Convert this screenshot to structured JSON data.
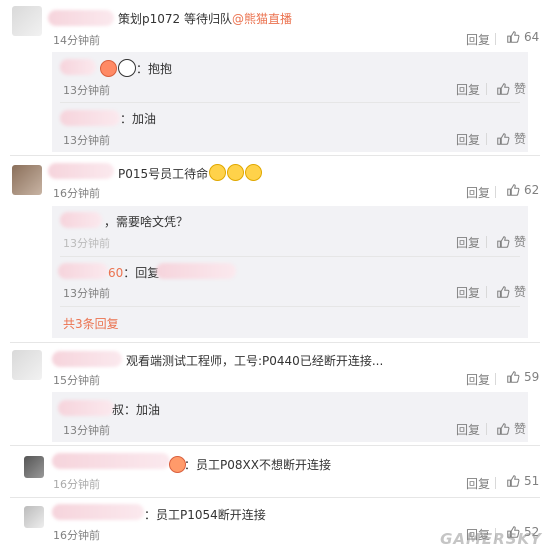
{
  "actions": {
    "reply_label": "回复",
    "like_label": "赞"
  },
  "comments": [
    {
      "text": "策划p1072 等待归队",
      "mention": "@熊猫直播",
      "time": "14分钟前",
      "likes": "64"
    },
    {
      "text": "P015号员工待命",
      "time": "16分钟前",
      "likes": "62"
    },
    {
      "text": "观看端测试工程师，工号:P0440已经断开连接...",
      "time": "15分钟前",
      "likes": "59"
    },
    {
      "text": "员工P08XX不想断开连接",
      "time": "16分钟前",
      "likes": "51"
    },
    {
      "text": "员工P1054断开连接",
      "time": "16分钟前",
      "likes": "52"
    }
  ],
  "replies": [
    {
      "text": "抱抱",
      "time": "13分钟前"
    },
    {
      "text": "：加油",
      "time": "13分钟前"
    },
    {
      "text": "，需要啥文凭？",
      "time": "13分钟前"
    },
    {
      "prefix": "60",
      "text": "：回复",
      "time": "13分钟前"
    },
    {
      "text": "叔：加油",
      "time": "13分钟前"
    }
  ],
  "expand_label": "共3条回复",
  "watermark": "GAMERSKY",
  "colors": {
    "link": "#eb7350",
    "sub_bg": "#f2f2f5",
    "meta": "#808080"
  }
}
